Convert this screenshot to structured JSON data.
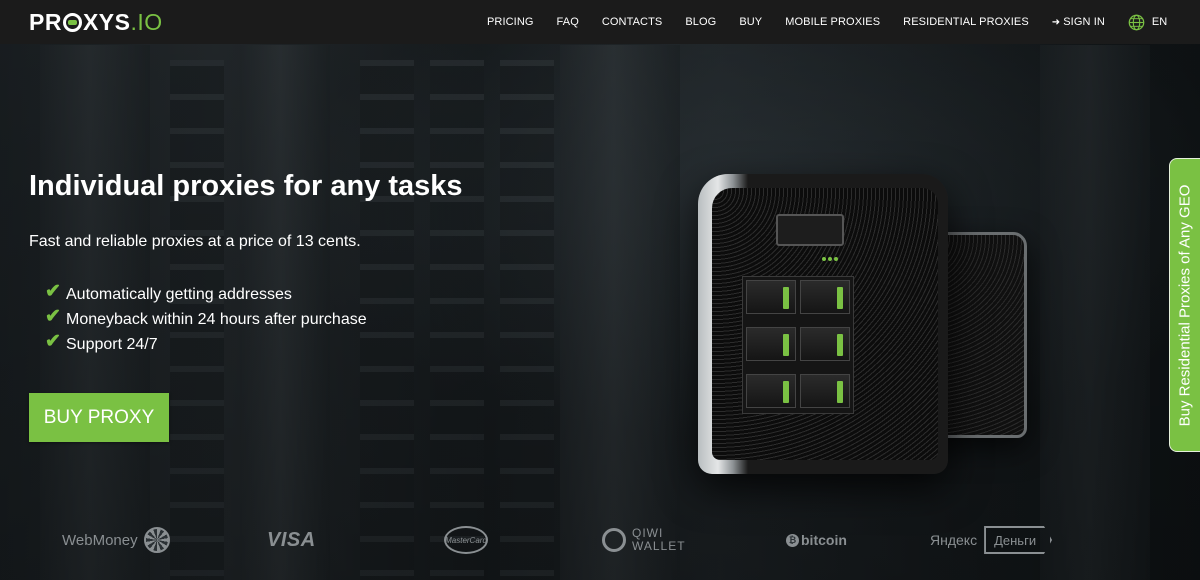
{
  "header": {
    "logo": {
      "prefix": "PR",
      "middle": "XYS",
      "suffix": ".IO"
    },
    "nav": [
      {
        "id": "pricing",
        "label": "PRICING"
      },
      {
        "id": "faq",
        "label": "FAQ"
      },
      {
        "id": "contacts",
        "label": "CONTACTS"
      },
      {
        "id": "blog",
        "label": "BLOG"
      },
      {
        "id": "buy",
        "label": "BUY"
      },
      {
        "id": "mobile-proxies",
        "label": "MOBILE PROXIES"
      },
      {
        "id": "residential-proxies",
        "label": "RESIDENTIAL PROXIES"
      }
    ],
    "signin": {
      "label": "SIGN IN",
      "icon": "sign-in-icon"
    },
    "language": {
      "label": "EN",
      "icon": "globe-icon"
    }
  },
  "hero": {
    "title": "Individual proxies for any tasks",
    "subtitle": "Fast and reliable proxies at a price of 13 cents.",
    "features": [
      "Automatically getting addresses",
      "Moneyback within 24 hours after purchase",
      "Support 24/7"
    ],
    "cta_label": "BUY PROXY"
  },
  "side_tab": {
    "label": "Buy Residential Proxies of Any GEO"
  },
  "payments": {
    "webmoney": "WebMoney",
    "visa": "VISA",
    "mastercard": "MasterCard",
    "qiwi_line1": "QIWI",
    "qiwi_line2": "WALLET",
    "bitcoin": "bitcoin",
    "yandex": "Яндекс",
    "dengi": "Деньги"
  },
  "colors": {
    "accent": "#7ac143",
    "header_bg": "#1b1b1b",
    "muted_logo": "#8a8f92"
  }
}
